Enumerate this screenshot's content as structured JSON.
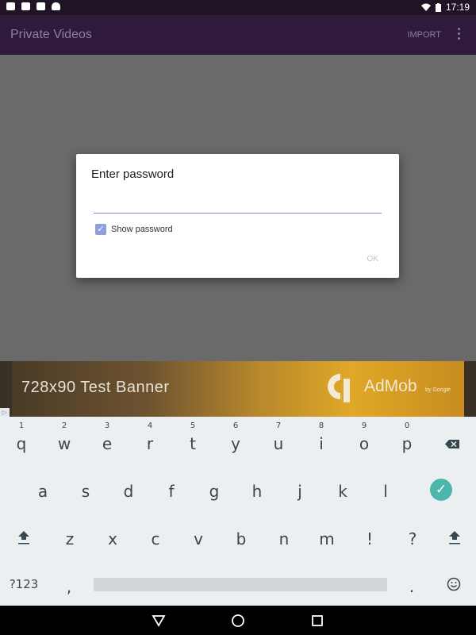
{
  "statusbar": {
    "time": "17:19"
  },
  "appbar": {
    "title": "Private Videos",
    "import_label": "IMPORT"
  },
  "dialog": {
    "title": "Enter password",
    "password_value": "",
    "show_password_label": "Show password",
    "show_password_checked": true,
    "ok_label": "OK"
  },
  "ad": {
    "banner_text": "728x90   Test Banner",
    "brand": "AdMob",
    "by": "by Google"
  },
  "keyboard": {
    "row1_hints": [
      "1",
      "2",
      "3",
      "4",
      "5",
      "6",
      "7",
      "8",
      "9",
      "0"
    ],
    "row1": [
      "q",
      "w",
      "e",
      "r",
      "t",
      "y",
      "u",
      "i",
      "o",
      "p"
    ],
    "row2": [
      "a",
      "s",
      "d",
      "f",
      "g",
      "h",
      "j",
      "k",
      "l"
    ],
    "row3": [
      "z",
      "x",
      "c",
      "v",
      "b",
      "n",
      "m",
      "!",
      "?"
    ],
    "symbols_label": "?123",
    "comma": ",",
    "period": "."
  },
  "colors": {
    "accent": "#7c8fd6",
    "enter": "#4db6ac",
    "appbar": "#2f1a3c"
  }
}
